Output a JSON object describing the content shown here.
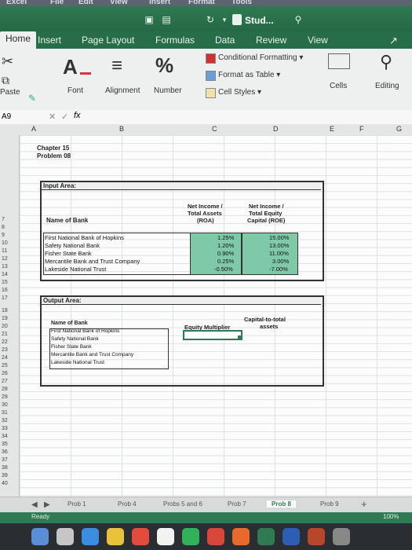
{
  "menubar": {
    "app": "Excel",
    "items": [
      "File",
      "Edit",
      "View",
      "Insert",
      "Format",
      "Tools"
    ]
  },
  "title": {
    "doc_name": "Stud..."
  },
  "ribbon_tabs": [
    "Home",
    "Insert",
    "Page Layout",
    "Formulas",
    "Data",
    "Review",
    "View"
  ],
  "ribbon": {
    "paste_label": "Paste",
    "font_label": "Font",
    "font_glyph": "A",
    "alignment_label": "Alignment",
    "number_label": "Number",
    "number_glyph": "%",
    "conditional_formatting": "Conditional Formatting",
    "format_as_table": "Format as Table",
    "cell_styles": "Cell Styles",
    "cells_label": "Cells",
    "editing_label": "Editing"
  },
  "formula_bar": {
    "name_box": "A9",
    "fx": "fx",
    "content": ""
  },
  "columns": [
    "A",
    "B",
    "C",
    "D",
    "E",
    "F",
    "G"
  ],
  "rows": [
    "7",
    "8",
    "9",
    "10",
    "11",
    "12",
    "13",
    "14",
    "15",
    "16",
    "17",
    "18",
    "19",
    "20",
    "21",
    "22",
    "23",
    "24",
    "25",
    "26",
    "27",
    "28",
    "29",
    "30",
    "31",
    "32",
    "33",
    "34",
    "35",
    "36",
    "37",
    "38",
    "39",
    "40"
  ],
  "sheet": {
    "chapter": "Chapter 15",
    "problem": "Problem 08",
    "input_area": "Input Area:",
    "col_roa": [
      "Net Income /",
      "Total Assets",
      "(ROA)"
    ],
    "col_roe": [
      "Net Income /",
      "Total Equity",
      "Capital (ROE)"
    ],
    "name_of_bank": "Name of Bank",
    "banks": [
      {
        "name": "First National Bank of Hopkins",
        "roa": "1.25%",
        "roe": "15.00%"
      },
      {
        "name": "Safety National Bank",
        "roa": "1.20%",
        "roe": "13.00%"
      },
      {
        "name": "Fisher State Bank",
        "roa": "0.90%",
        "roe": "11.00%"
      },
      {
        "name": "Mercantile Bank and Trust Company",
        "roa": "0.25%",
        "roe": "3.00%"
      },
      {
        "name": "Lakeside National Trust",
        "roa": "-0.50%",
        "roe": "-7.00%"
      }
    ],
    "output_area": "Output Area:",
    "out_name_of_bank": "Name of Bank",
    "equity_multiplier": "Equity Multiplier",
    "capital_to_total": [
      "Capital-to-total",
      "assets"
    ]
  },
  "sheet_tabs": [
    "Prob 1",
    "Prob 4",
    "Probs 5 and 6",
    "Prob 7",
    "Prob 8",
    "Prob 9"
  ],
  "status": {
    "ready": "Ready",
    "zoom": "100%"
  },
  "colors": {
    "excel_green": "#2f7a52",
    "highlight_fill": "#7fc9a8"
  }
}
